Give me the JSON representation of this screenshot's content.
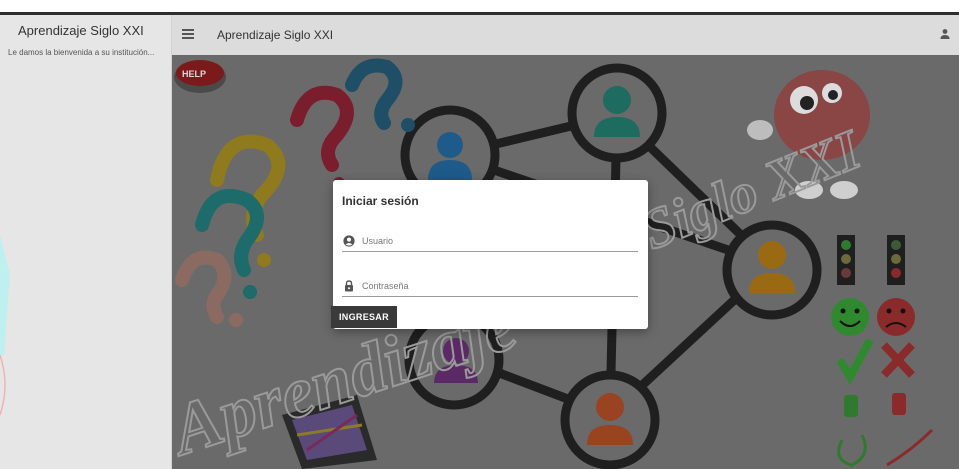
{
  "sidebar": {
    "title": "Aprendizaje Siglo XXI",
    "welcome": "Le damos la bienvenida a su institución..."
  },
  "appbar": {
    "title": "Aprendizaje Siglo XXI"
  },
  "background": {
    "help_label": "HELP",
    "watermark_main": "Aprendizaje",
    "watermark_side": "Siglo XXI"
  },
  "login": {
    "title": "Iniciar sesión",
    "username_placeholder": "Usuario",
    "password_placeholder": "Contraseña",
    "submit_label": "INGRESAR"
  },
  "colors": {
    "sidebar_bg": "#e6e6e6",
    "appbar_bg": "#dcdcdc",
    "button_bg": "#3a3a3a",
    "backdrop": "#6a6a6a"
  }
}
